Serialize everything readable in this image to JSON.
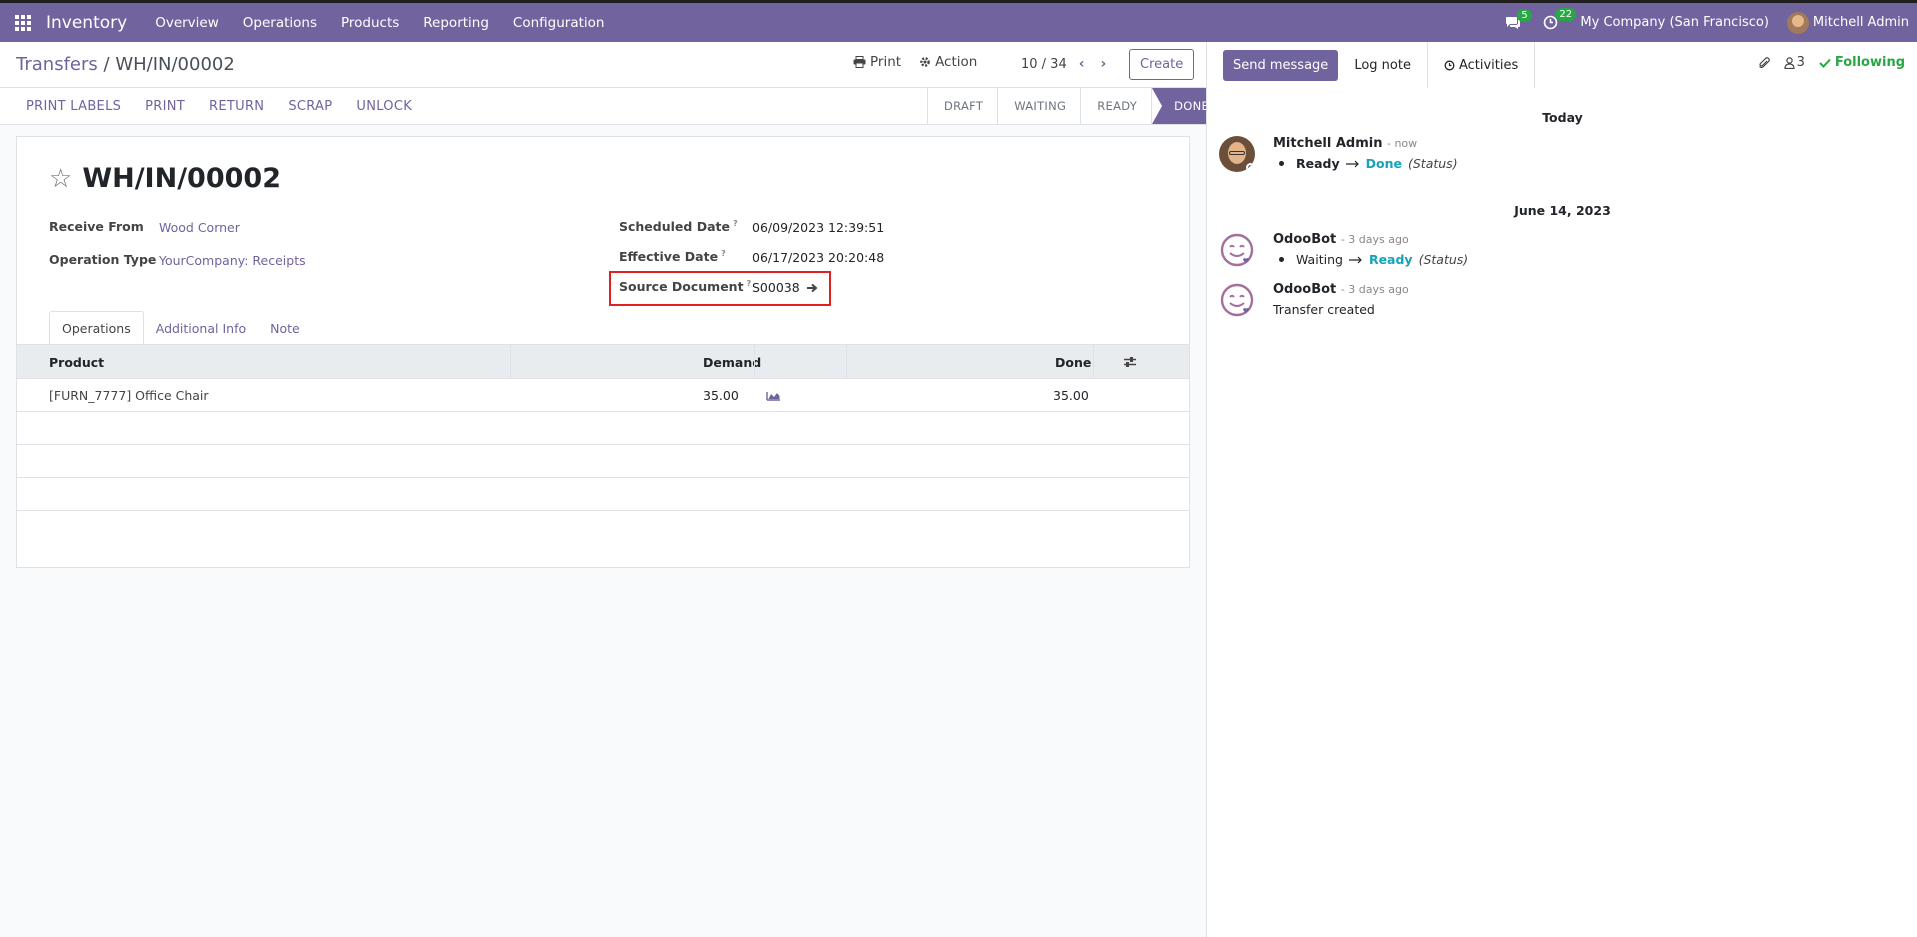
{
  "navbar": {
    "app_name": "Inventory",
    "menu": [
      "Overview",
      "Operations",
      "Products",
      "Reporting",
      "Configuration"
    ],
    "messages_count": "5",
    "activities_count": "22",
    "company": "My Company (San Francisco)",
    "user": "Mitchell Admin"
  },
  "breadcrumb": {
    "parent": "Transfers",
    "separator": "/",
    "current": "WH/IN/00002"
  },
  "toolbar": {
    "print_label": "Print",
    "action_label": "Action",
    "pager": "10 / 34",
    "create_label": "Create"
  },
  "statusbar": {
    "buttons": [
      "PRINT LABELS",
      "PRINT",
      "RETURN",
      "SCRAP",
      "UNLOCK"
    ],
    "stages": [
      "DRAFT",
      "WAITING",
      "READY",
      "DONE"
    ],
    "active_stage": "DONE"
  },
  "form": {
    "name": "WH/IN/00002",
    "receive_from_label": "Receive From",
    "receive_from": "Wood Corner",
    "operation_type_label": "Operation Type",
    "operation_type": "YourCompany: Receipts",
    "scheduled_date_label": "Scheduled Date",
    "scheduled_date": "06/09/2023 12:39:51",
    "effective_date_label": "Effective Date",
    "effective_date": "06/17/2023 20:20:48",
    "source_document_label": "Source Document",
    "source_document": "S00038",
    "help_mark": "?",
    "tabs": [
      "Operations",
      "Additional Info",
      "Note"
    ],
    "table": {
      "columns": [
        "Product",
        "Demand",
        "Done"
      ],
      "rows": [
        {
          "product": "[FURN_7777] Office Chair",
          "demand": "35.00",
          "done": "35.00"
        }
      ]
    }
  },
  "chatter": {
    "send_message": "Send message",
    "log_note": "Log note",
    "activities": "Activities",
    "followers_count": "3",
    "following": "Following",
    "groups": [
      {
        "date": "Today",
        "messages": [
          {
            "author": "Mitchell Admin",
            "when": "- now",
            "old": "Ready",
            "new": "Done",
            "field": "(Status)"
          }
        ]
      },
      {
        "date": "June 14, 2023",
        "messages": [
          {
            "author": "OdooBot",
            "when": "- 3 days ago",
            "old": "Waiting",
            "new": "Ready",
            "field": "(Status)"
          },
          {
            "author": "OdooBot",
            "when": "- 3 days ago",
            "text": "Transfer created"
          }
        ]
      }
    ]
  },
  "colors": {
    "brand": "#71639e",
    "following": "#28a745",
    "tracking_new": "#17a2b8",
    "highlight_box": "#e02020"
  }
}
